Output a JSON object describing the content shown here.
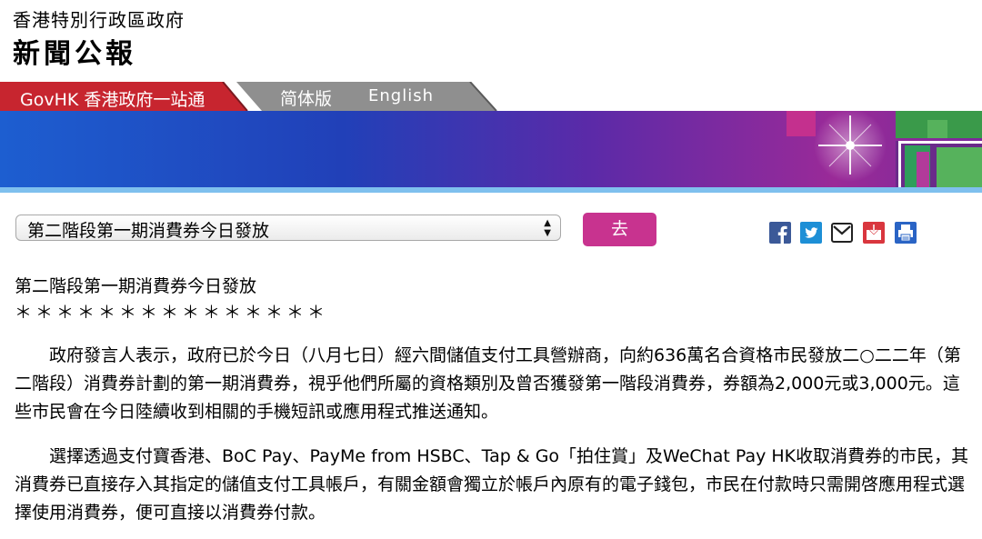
{
  "header": {
    "gov_name": "香港特別行政區政府",
    "pr_title": "新聞公報"
  },
  "tabs": {
    "govhk": "GovHK 香港政府一站通",
    "simplified": "简体版",
    "english": "English"
  },
  "colors": {
    "tab_red": "#c7252f",
    "tab_grey": "#8a8a8a",
    "go_button": "#c8338f",
    "banner_blue": "#1a55c8",
    "banner_purple": "#8a2a9a"
  },
  "controls": {
    "selected_release": "第二階段第一期消費券今日發放",
    "go_label": "去",
    "share_icons": [
      "facebook-icon",
      "twitter-icon",
      "email-icon",
      "save-icon",
      "print-icon"
    ]
  },
  "article": {
    "title": "第二階段第一期消費券今日發放",
    "stars": "＊＊＊＊＊＊＊＊＊＊＊＊＊＊＊",
    "paragraphs": [
      "政府發言人表示，政府已於今日（八月七日）經六間儲值支付工具營辦商，向約636萬名合資格市民發放二○二二年（第二階段）消費券計劃的第一期消費券，視乎他們所屬的資格類別及曾否獲發第一階段消費券，券額為2,000元或3,000元。這些市民會在今日陸續收到相關的手機短訊或應用程式推送通知。",
      "選擇透過支付寶香港、BoC Pay、PayMe from HSBC、Tap & Go「拍住賞」及WeChat Pay HK收取消費券的市民，其消費券已直接存入其指定的儲值支付工具帳戶，有關金額會獨立於帳戶內原有的電子錢包，市民在付款時只需開啓應用程式選擇使用消費券，便可直接以消費券付款。"
    ]
  }
}
